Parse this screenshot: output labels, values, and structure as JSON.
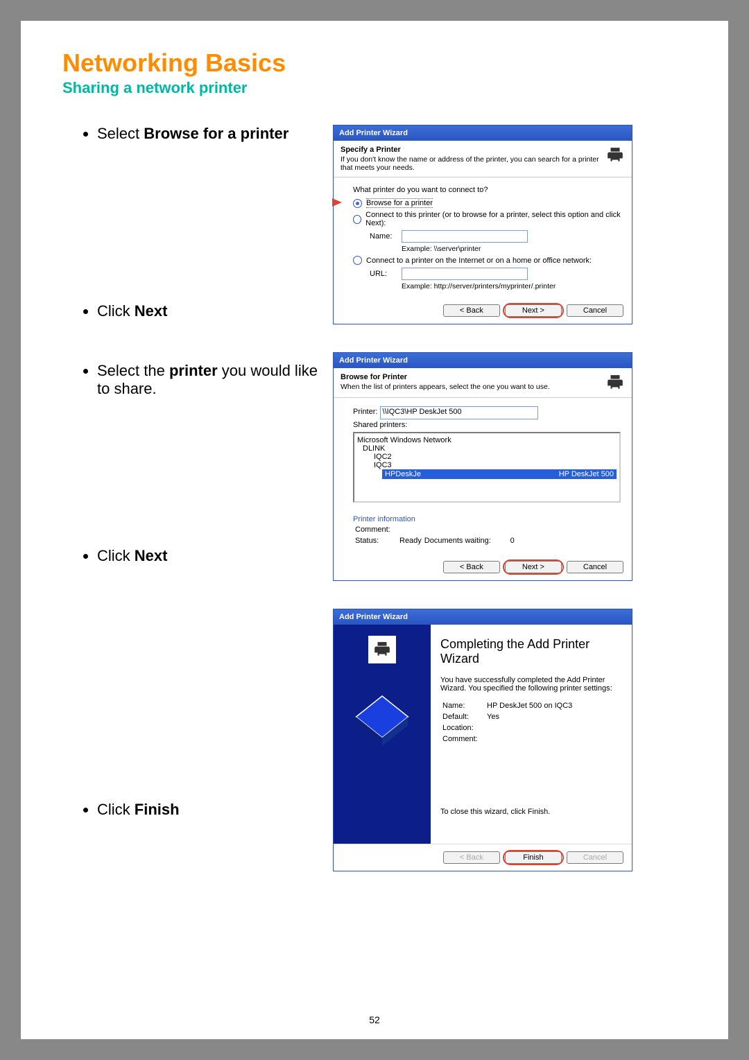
{
  "page_number": "52",
  "header": {
    "title": "Networking Basics",
    "subtitle": "Sharing a network printer"
  },
  "instructions": {
    "i1a": "Select ",
    "i1b": "Browse for a printer",
    "i2a": "Click ",
    "i2b": "Next",
    "i3a": "Select the ",
    "i3b": "printer",
    "i3c": " you would like to share.",
    "i4a": "Click ",
    "i4b": "Next",
    "i5a": "Click ",
    "i5b": "Finish"
  },
  "wizard1": {
    "title": "Add Printer Wizard",
    "head_h1": "Specify a Printer",
    "head_h2": "If you don't know the name or address of the printer, you can search for a printer that meets your needs.",
    "question": "What printer do you want to connect to?",
    "opt_browse": "Browse for a printer",
    "opt_connect": "Connect to this printer (or to browse for a printer, select this option and click Next):",
    "name_label": "Name:",
    "name_example": "Example: \\\\server\\printer",
    "opt_internet": "Connect to a printer on the Internet or on a home or office network:",
    "url_label": "URL:",
    "url_example": "Example: http://server/printers/myprinter/.printer",
    "btn_back": "< Back",
    "btn_next": "Next >",
    "btn_cancel": "Cancel"
  },
  "wizard2": {
    "title": "Add Printer Wizard",
    "head_h1": "Browse for Printer",
    "head_h2": "When the list of printers appears, select the one you want to use.",
    "printer_label": "Printer:",
    "printer_value": "\\\\IQC3\\HP DeskJet 500",
    "shared_label": "Shared printers:",
    "tree_root": "Microsoft Windows Network",
    "tree_n1": "DLINK",
    "tree_n2": "IQC2",
    "tree_n3": "IQC3",
    "tree_sel_name": "HPDeskJe",
    "tree_sel_desc": "HP DeskJet 500",
    "pinfo_title": "Printer information",
    "comment_label": "Comment:",
    "status_label": "Status:",
    "status_value": "Ready",
    "docs_label": "Documents waiting:",
    "docs_value": "0",
    "btn_back": "< Back",
    "btn_next": "Next >",
    "btn_cancel": "Cancel"
  },
  "wizard3": {
    "title": "Add Printer Wizard",
    "heading": "Completing the Add Printer Wizard",
    "msg1": "You have successfully completed the Add Printer Wizard. You specified the following printer settings:",
    "name_label": "Name:",
    "name_value": "HP DeskJet 500 on IQC3",
    "default_label": "Default:",
    "default_value": "Yes",
    "location_label": "Location:",
    "comment_label": "Comment:",
    "close_txt": "To close this wizard, click Finish.",
    "btn_back": "< Back",
    "btn_finish": "Finish",
    "btn_cancel": "Cancel"
  }
}
